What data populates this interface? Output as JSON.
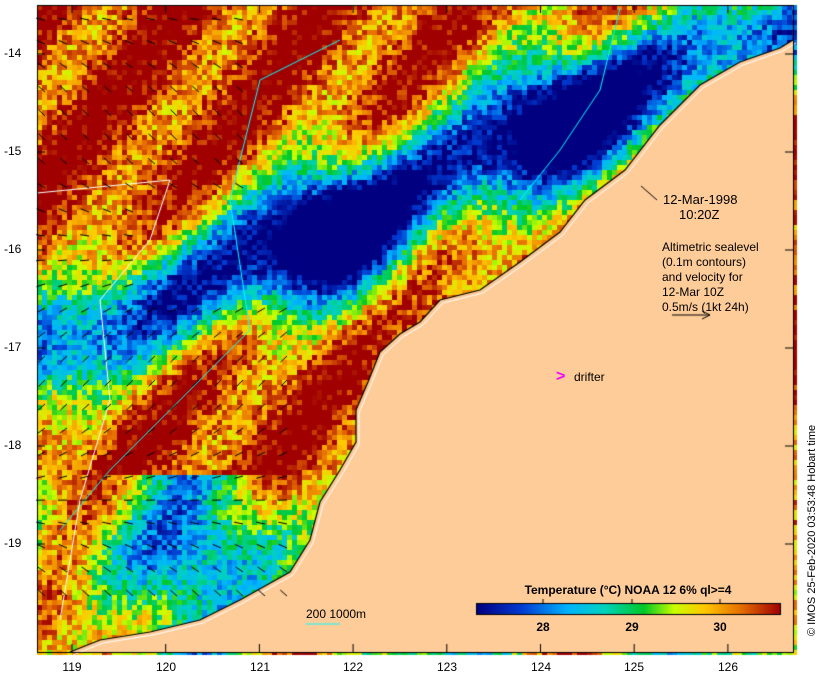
{
  "map": {
    "date": "12-Mar-1998",
    "time": "10:20Z",
    "legend_lines": [
      "Altimetric sealevel",
      "(0.1m contours)",
      "and velocity for",
      "12-Mar 10Z",
      "0.5m/s (1kt 24h)"
    ],
    "drifter_label": "drifter",
    "drifter_symbol": ">",
    "isobath_label": "200  1000m",
    "lat_ticks": [
      "-14",
      "-15",
      "-16",
      "-17",
      "-18",
      "-19"
    ],
    "lon_ticks": [
      "119",
      "120",
      "121",
      "122",
      "123",
      "124",
      "125",
      "126"
    ],
    "colorbar": {
      "title": "Temperature (°C) NOAA 12 6% ql>=4",
      "ticks": [
        "28",
        "29",
        "30"
      ],
      "range": [
        27.25,
        30.7
      ]
    },
    "credit": "© IMOS 25-Feb-2020 03:53:48 Hobart time",
    "colors": {
      "land": "#fecc99",
      "drifter": "#ff00ff",
      "isobath": "#00ffff",
      "contour": "#ffffff"
    }
  }
}
